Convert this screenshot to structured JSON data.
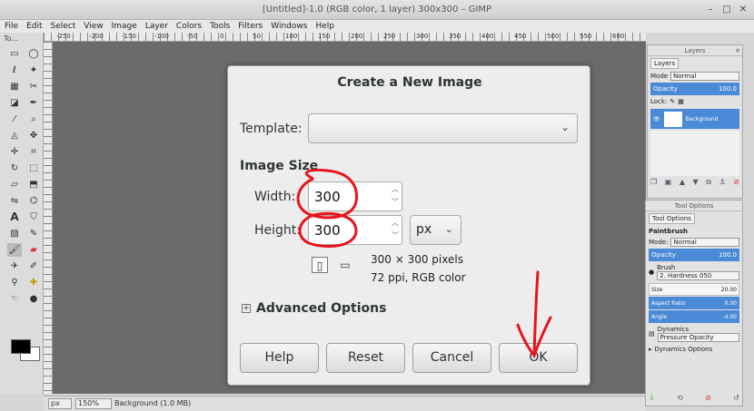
{
  "window": {
    "title": "[Untitled]-1.0 (RGB color, 1 layer) 300x300 – GIMP"
  },
  "menu": [
    "File",
    "Edit",
    "Select",
    "View",
    "Image",
    "Layer",
    "Colors",
    "Tools",
    "Filters",
    "Windows",
    "Help"
  ],
  "toolbox": {
    "title": "To..."
  },
  "ruler": {
    "labels": [
      "-250",
      "-200",
      "-150",
      "-100",
      "-50",
      "0",
      "50",
      "100",
      "150",
      "200",
      "250",
      "300",
      "350",
      "400",
      "450",
      "500",
      "550",
      "600"
    ]
  },
  "status": {
    "unit": "px",
    "zoom": "150%",
    "text": "Background (1.0 MB)"
  },
  "layers_panel": {
    "title": "Layers",
    "tab": "Layers",
    "mode_label": "Mode",
    "mode_value": "Normal",
    "opacity_label": "Opacity",
    "opacity_value": "100.0",
    "lock_label": "Lock:",
    "layer_name": "Background"
  },
  "tool_options": {
    "title": "Tool Options",
    "tab": "Tool Options",
    "tool_name": "Paintbrush",
    "mode_label": "Mode:",
    "mode_value": "Normal",
    "opacity_label": "Opacity",
    "opacity_value": "100.0",
    "brush_label": "Brush",
    "brush_value": "2. Hardness 050",
    "size_label": "Size",
    "size_value": "20.00",
    "aspect_label": "Aspect Ratio",
    "aspect_value": "0.00",
    "angle_label": "Angle",
    "angle_value": "-4.00",
    "dynamics_label": "Dynamics",
    "dynamics_value": "Pressure Opacity",
    "dynamics_options": "Dynamics Options"
  },
  "dialog": {
    "title": "Create a New Image",
    "template_label": "Template:",
    "template_value": "",
    "image_size_label": "Image Size",
    "width_label": "Width:",
    "width_value": "300",
    "height_label": "Height:",
    "height_value": "300",
    "unit_value": "px",
    "info_pixels": "300 × 300 pixels",
    "info_res": "72 ppi, RGB color",
    "advanced_label": "Advanced Options",
    "buttons": {
      "help": "Help",
      "reset": "Reset",
      "cancel": "Cancel",
      "ok": "OK"
    }
  },
  "colors": {
    "selection_blue": "#4a8ad6",
    "annotation_red": "#e8141b"
  }
}
